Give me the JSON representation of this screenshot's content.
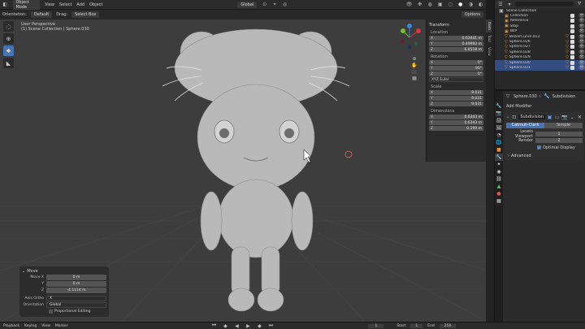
{
  "topbar": {
    "mode": "Object Mode",
    "menus": [
      "View",
      "Select",
      "Add",
      "Object"
    ],
    "transform_orientation": "Global",
    "options_label": "Options"
  },
  "toolhdr": {
    "orientation_label": "Orientation:",
    "orientation_value": "Default",
    "drag_label": "Drag:",
    "drag_value": "Select Box"
  },
  "viewport": {
    "view_name": "User Perspective",
    "collection_info": "(1) Scene Collection | Sphere.030"
  },
  "npanel": {
    "transform_title": "Transform",
    "location_label": "Location",
    "location": [
      {
        "k": "X",
        "v": "0.63441 m"
      },
      {
        "k": "Y",
        "v": "0.49993 m"
      },
      {
        "k": "Z",
        "v": "6.8518 m"
      }
    ],
    "rotation_label": "Rotation",
    "rotation": [
      {
        "k": "X",
        "v": "0°"
      },
      {
        "k": "Y",
        "v": "90°"
      },
      {
        "k": "Z",
        "v": "0°"
      }
    ],
    "rotation_mode": "XYZ Euler",
    "scale_label": "Scale",
    "scale": [
      {
        "k": "X",
        "v": "9.031"
      },
      {
        "k": "Y",
        "v": "9.031"
      },
      {
        "k": "Z",
        "v": "9.031"
      }
    ],
    "dimensions_label": "Dimensions",
    "dimensions": [
      {
        "k": "X",
        "v": "0.6343 m"
      },
      {
        "k": "Y",
        "v": "0.6343 m"
      },
      {
        "k": "Z",
        "v": "0.199 m"
      }
    ],
    "side_tabs": [
      "Item",
      "Tool",
      "View"
    ]
  },
  "outliner": {
    "title": "Scene Collection",
    "rows": [
      {
        "name": "Collection",
        "sel": false
      },
      {
        "name": "Reference",
        "sel": false
      },
      {
        "name": "Stop",
        "sel": false
      },
      {
        "name": "WIP",
        "sel": false
      },
      {
        "name": "BezierCurve.013",
        "sel": false
      },
      {
        "name": "Sphere.026",
        "sel": false
      },
      {
        "name": "Sphere.027",
        "sel": false
      },
      {
        "name": "Sphere.028",
        "sel": false
      },
      {
        "name": "Sphere.029",
        "sel": false
      },
      {
        "name": "Sphere.030",
        "sel": true
      },
      {
        "name": "Sphere.031",
        "sel": true
      }
    ]
  },
  "props": {
    "object_name": "Sphere.030",
    "modifier_name": "Subdivision",
    "add_modifier": "Add Modifier",
    "mod_name": "Subdivision",
    "method_a": "Catmull-Clark",
    "method_b": "Simple",
    "levels_viewport_label": "Levels Viewport",
    "levels_viewport": "1",
    "render_label": "Render",
    "render": "2",
    "optimal_display": "Optimal Display",
    "advanced": "Advanced"
  },
  "oppanel": {
    "title": "Move",
    "rows": [
      {
        "lab": "Move X",
        "val": "0 m"
      },
      {
        "lab": "Y",
        "val": "0 m"
      },
      {
        "lab": "Z",
        "val": "-4.1114 m"
      }
    ],
    "axis_label": "Axis Ortho",
    "axis_value": "X",
    "orient_label": "Orientation",
    "orient_value": "Global",
    "proportional": "Proportional Editing"
  },
  "timeline": {
    "menus": [
      "Playback",
      "Keying",
      "View",
      "Marker"
    ],
    "current_frame": "1",
    "start_label": "Start",
    "start": "1",
    "end_label": "End",
    "end": "250"
  },
  "colors": {
    "accent": "#4772b3",
    "viewport_bg": "#3d3d3d",
    "panel_bg": "#2b2b2b"
  }
}
